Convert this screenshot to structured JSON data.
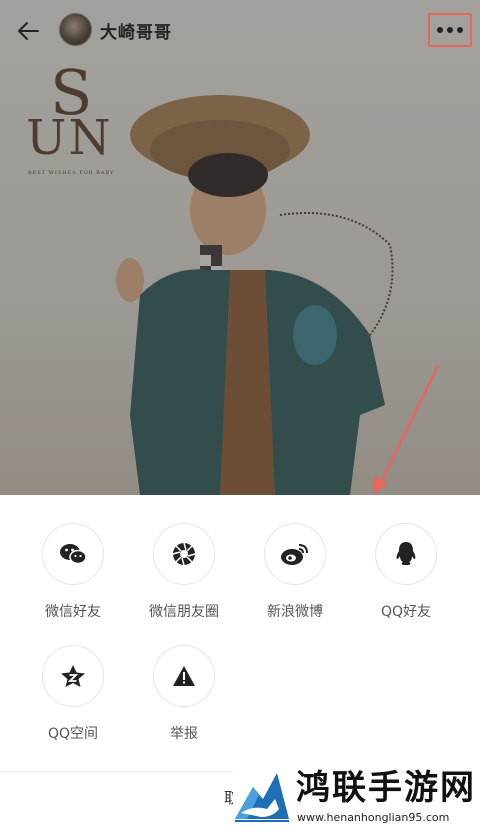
{
  "header": {
    "username": "大崎哥哥"
  },
  "poster": {
    "logo_big": "S",
    "logo_word": "UN",
    "logo_tagline": "BEST WISHES FOR BABY"
  },
  "share": {
    "items": [
      {
        "label": "微信好友",
        "icon": "wechat-icon"
      },
      {
        "label": "微信朋友圈",
        "icon": "wechat-moments-icon"
      },
      {
        "label": "新浪微博",
        "icon": "weibo-icon"
      },
      {
        "label": "QQ好友",
        "icon": "qq-icon"
      },
      {
        "label": "QQ空间",
        "icon": "qzone-icon"
      },
      {
        "label": "举报",
        "icon": "report-icon"
      }
    ],
    "cancel_partial": "取"
  },
  "watermark": {
    "title": "鸿联手游网",
    "url": "www.henanhonglian95.com"
  },
  "colors": {
    "highlight": "#e7675c",
    "text": "#222222",
    "label": "#555555"
  }
}
